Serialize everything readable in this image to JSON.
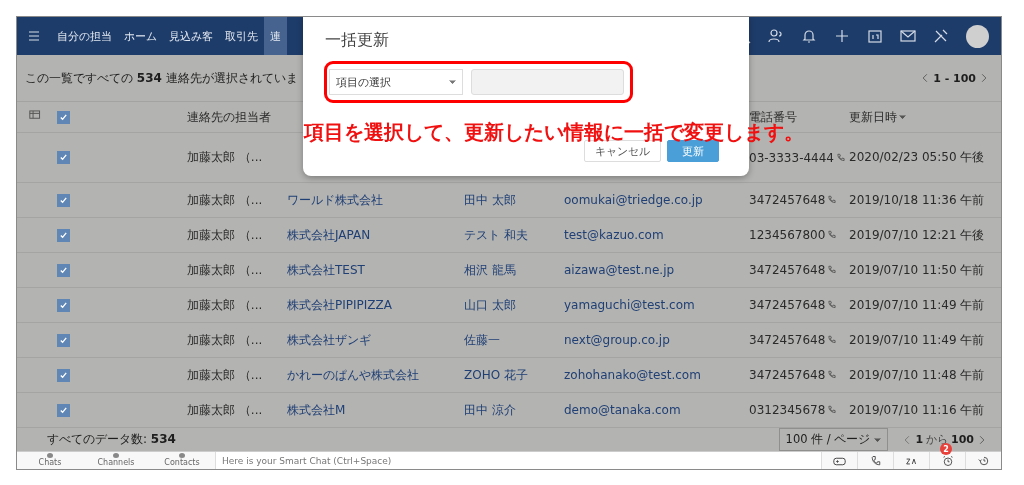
{
  "nav": {
    "tabs": [
      {
        "label": "自分の担当",
        "selected": false
      },
      {
        "label": "ホーム",
        "selected": false
      },
      {
        "label": "見込み客",
        "selected": false
      },
      {
        "label": "取引先",
        "selected": false
      },
      {
        "label": "連",
        "selected": true
      }
    ]
  },
  "toolbar": {
    "selection_notice": "この一覧ですべての **534** 連絡先が選択されていま",
    "range": "1 - 100"
  },
  "table": {
    "header": {
      "checked": true,
      "owner": "連絡先の担当者",
      "phone": "電話番号",
      "date": "更新日時"
    },
    "rows": [
      {
        "checked": true,
        "owner": "加藤太郎 （...",
        "phone": "03-3333-4444",
        "date": "2020/02/23 05:50 午後"
      },
      {
        "checked": true,
        "owner": "加藤太郎 （...",
        "account": "ワールド株式会社",
        "contact": "田中 太郎",
        "email": "oomukai@triedge.co.jp",
        "phone": "3472457648",
        "date": "2019/10/18 11:36 午前"
      },
      {
        "checked": true,
        "owner": "加藤太郎 （...",
        "account": "株式会社JAPAN",
        "contact": "テスト 和夫",
        "email": "test@kazuo.com",
        "phone": "1234567800",
        "date": "2019/07/10 12:21 午後"
      },
      {
        "checked": true,
        "owner": "加藤太郎 （...",
        "account": "株式会社TEST",
        "contact": "相沢 龍馬",
        "email": "aizawa@test.ne.jp",
        "phone": "3472457648",
        "date": "2019/07/10 11:50 午前"
      },
      {
        "checked": true,
        "owner": "加藤太郎 （...",
        "account": "株式会社PIPIPIZZA",
        "contact": "山口 太郎",
        "email": "yamaguchi@test.com",
        "phone": "3472457648",
        "date": "2019/07/10 11:49 午前"
      },
      {
        "checked": true,
        "owner": "加藤太郎 （...",
        "account": "株式会社ザンギ",
        "contact": "佐藤一",
        "email": "next@group.co.jp",
        "phone": "3472457648",
        "date": "2019/07/10 11:49 午前"
      },
      {
        "checked": true,
        "owner": "加藤太郎 （...",
        "account": "かれーのぱんや株式会社",
        "contact": "ZOHO 花子",
        "email": "zohohanako@test.com",
        "phone": "3472457648",
        "date": "2019/07/10 11:48 午前"
      },
      {
        "checked": true,
        "owner": "加藤太郎 （...",
        "account": "株式会社M",
        "contact": "田中 涼介",
        "email": "demo@tanaka.com",
        "phone": "0312345678",
        "date": "2019/07/10 11:16 午前"
      }
    ]
  },
  "footer": {
    "total": "すべてのデータ数: **534**",
    "per_page": "100 件 / ページ",
    "page_from": "1",
    "page_sep": "から",
    "page_to": "100"
  },
  "chat_bar": {
    "tabs": [
      "Chats",
      "Channels",
      "Contacts"
    ],
    "placeholder": "Here is your Smart Chat (Ctrl+Space)",
    "alarm_badge": "2"
  },
  "dialog": {
    "title": "一括更新",
    "select": "項目の選択",
    "cancel": "キャンセル",
    "update": "更新"
  },
  "annotation": "項目を選択して、更新したい情報に一括で変更します。"
}
